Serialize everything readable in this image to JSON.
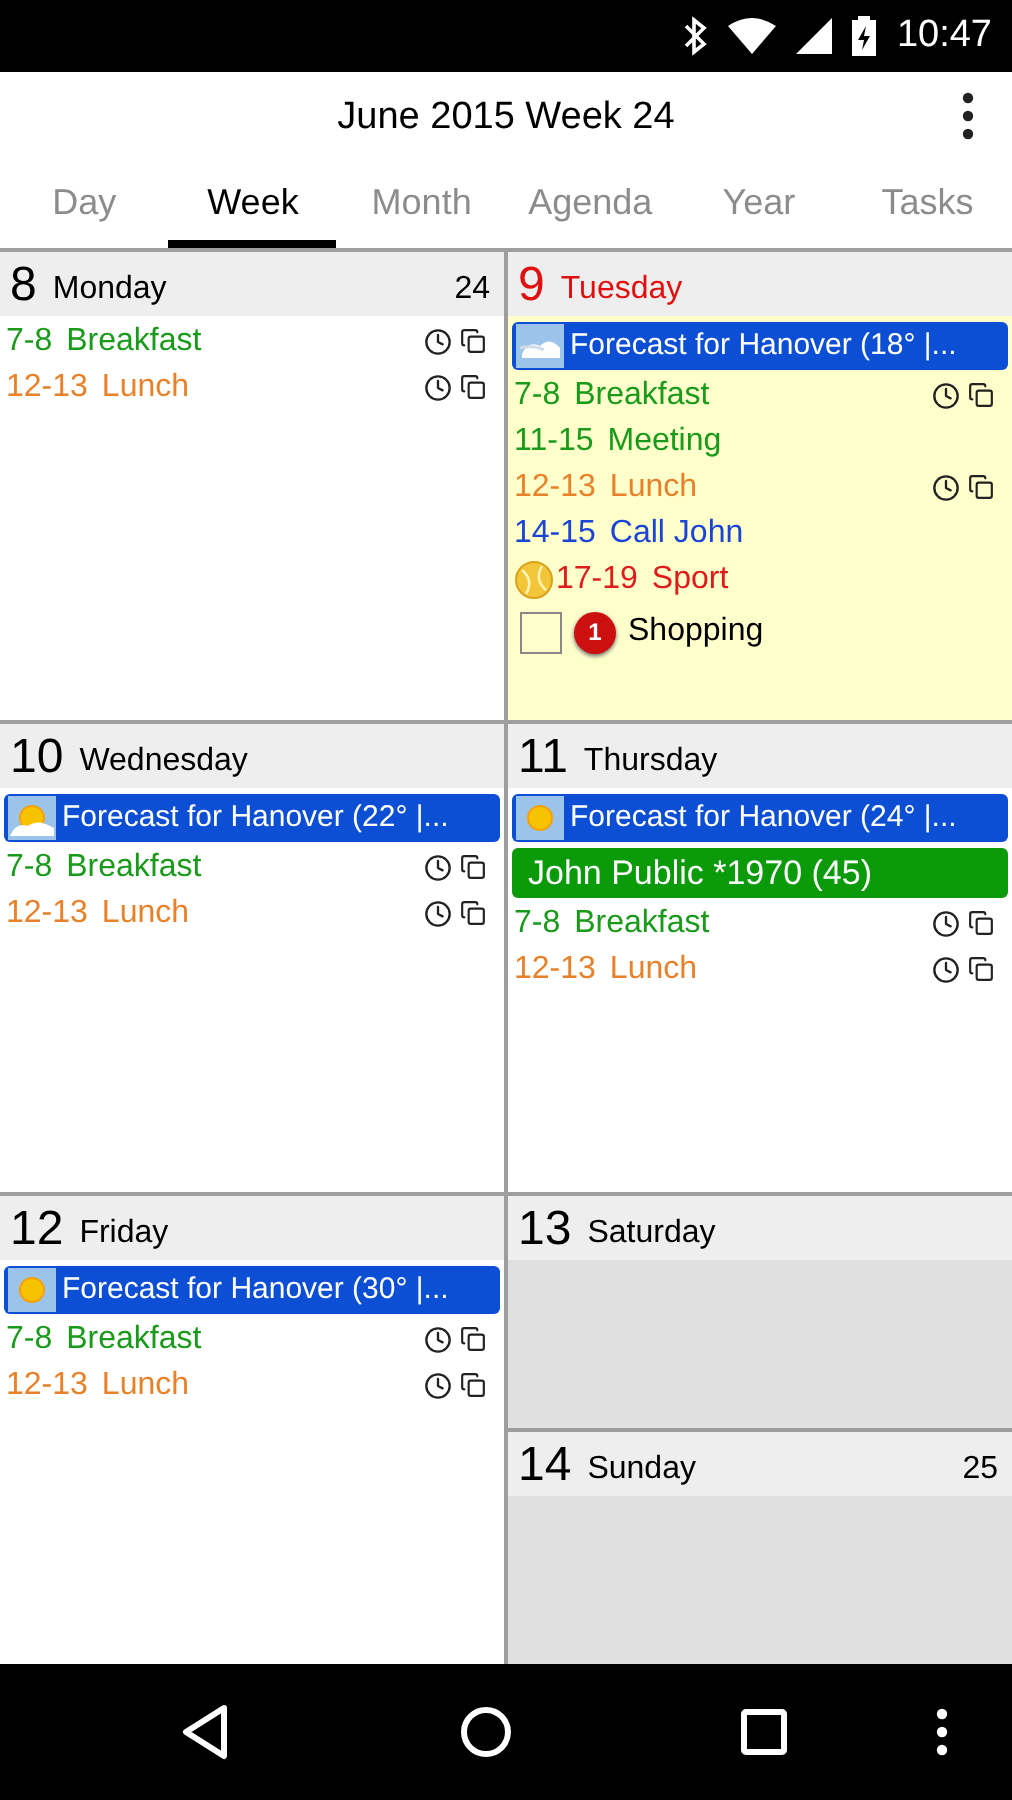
{
  "status_bar": {
    "time": "10:47"
  },
  "header": {
    "title": "June 2015 Week 24"
  },
  "tabs": [
    {
      "label": "Day",
      "selected": false
    },
    {
      "label": "Week",
      "selected": true
    },
    {
      "label": "Month",
      "selected": false
    },
    {
      "label": "Agenda",
      "selected": false
    },
    {
      "label": "Year",
      "selected": false
    },
    {
      "label": "Tasks",
      "selected": false
    }
  ],
  "days": [
    {
      "number": "8",
      "name": "Monday",
      "week": "24",
      "today": false,
      "weekend": false,
      "items": [
        {
          "kind": "event",
          "time": "7-8",
          "title": "Breakfast",
          "color": "#1a9a1a",
          "alarm": true,
          "recurring": true
        },
        {
          "kind": "event",
          "time": "12-13",
          "title": "Lunch",
          "color": "#e8822a",
          "alarm": true,
          "recurring": true
        }
      ]
    },
    {
      "number": "9",
      "name": "Tuesday",
      "today": true,
      "weekend": false,
      "items": [
        {
          "kind": "forecast",
          "text": "Forecast for Hanover (18° |...",
          "weather": {
            "kind": "cloudy"
          }
        },
        {
          "kind": "event",
          "time": "7-8",
          "title": "Breakfast",
          "color": "#1a9a1a",
          "alarm": true,
          "recurring": true
        },
        {
          "kind": "event",
          "time": "11-15",
          "title": "Meeting",
          "color": "#1a9a1a",
          "alarm": false,
          "recurring": false
        },
        {
          "kind": "event",
          "time": "12-13",
          "title": "Lunch",
          "color": "#e8822a",
          "alarm": true,
          "recurring": true
        },
        {
          "kind": "event",
          "time": "14-15",
          "title": "Call John",
          "color": "#1a44d6",
          "alarm": false,
          "recurring": false
        },
        {
          "kind": "event",
          "time": "17-19",
          "title": "Sport",
          "color": "#e01b1b",
          "alarm": false,
          "recurring": false,
          "ball": true
        },
        {
          "kind": "task",
          "title": "Shopping",
          "checked": false,
          "priority": "1"
        }
      ]
    },
    {
      "number": "10",
      "name": "Wednesday",
      "today": false,
      "weekend": false,
      "items": [
        {
          "kind": "forecast",
          "text": "Forecast for Hanover (22° |...",
          "weather": {
            "kind": "partly-sunny"
          }
        },
        {
          "kind": "event",
          "time": "7-8",
          "title": "Breakfast",
          "color": "#1a9a1a",
          "alarm": true,
          "recurring": true
        },
        {
          "kind": "event",
          "time": "12-13",
          "title": "Lunch",
          "color": "#e8822a",
          "alarm": true,
          "recurring": true
        }
      ]
    },
    {
      "number": "11",
      "name": "Thursday",
      "today": false,
      "weekend": false,
      "items": [
        {
          "kind": "forecast",
          "text": "Forecast for Hanover (24° |...",
          "weather": {
            "kind": "sunny"
          }
        },
        {
          "kind": "birthday",
          "text": "John Public *1970 (45)"
        },
        {
          "kind": "event",
          "time": "7-8",
          "title": "Breakfast",
          "color": "#1a9a1a",
          "alarm": true,
          "recurring": true
        },
        {
          "kind": "event",
          "time": "12-13",
          "title": "Lunch",
          "color": "#e8822a",
          "alarm": true,
          "recurring": true
        }
      ]
    },
    {
      "number": "12",
      "name": "Friday",
      "today": false,
      "weekend": false,
      "items": [
        {
          "kind": "forecast",
          "text": "Forecast for Hanover (30° |...",
          "weather": {
            "kind": "sunny"
          }
        },
        {
          "kind": "event",
          "time": "7-8",
          "title": "Breakfast",
          "color": "#1a9a1a",
          "alarm": true,
          "recurring": true
        },
        {
          "kind": "event",
          "time": "12-13",
          "title": "Lunch",
          "color": "#e8822a",
          "alarm": true,
          "recurring": true
        }
      ]
    },
    {
      "number": "13",
      "name": "Saturday",
      "today": false,
      "weekend": true
    },
    {
      "number": "14",
      "name": "Sunday",
      "week": "25",
      "today": false,
      "weekend": true
    }
  ]
}
